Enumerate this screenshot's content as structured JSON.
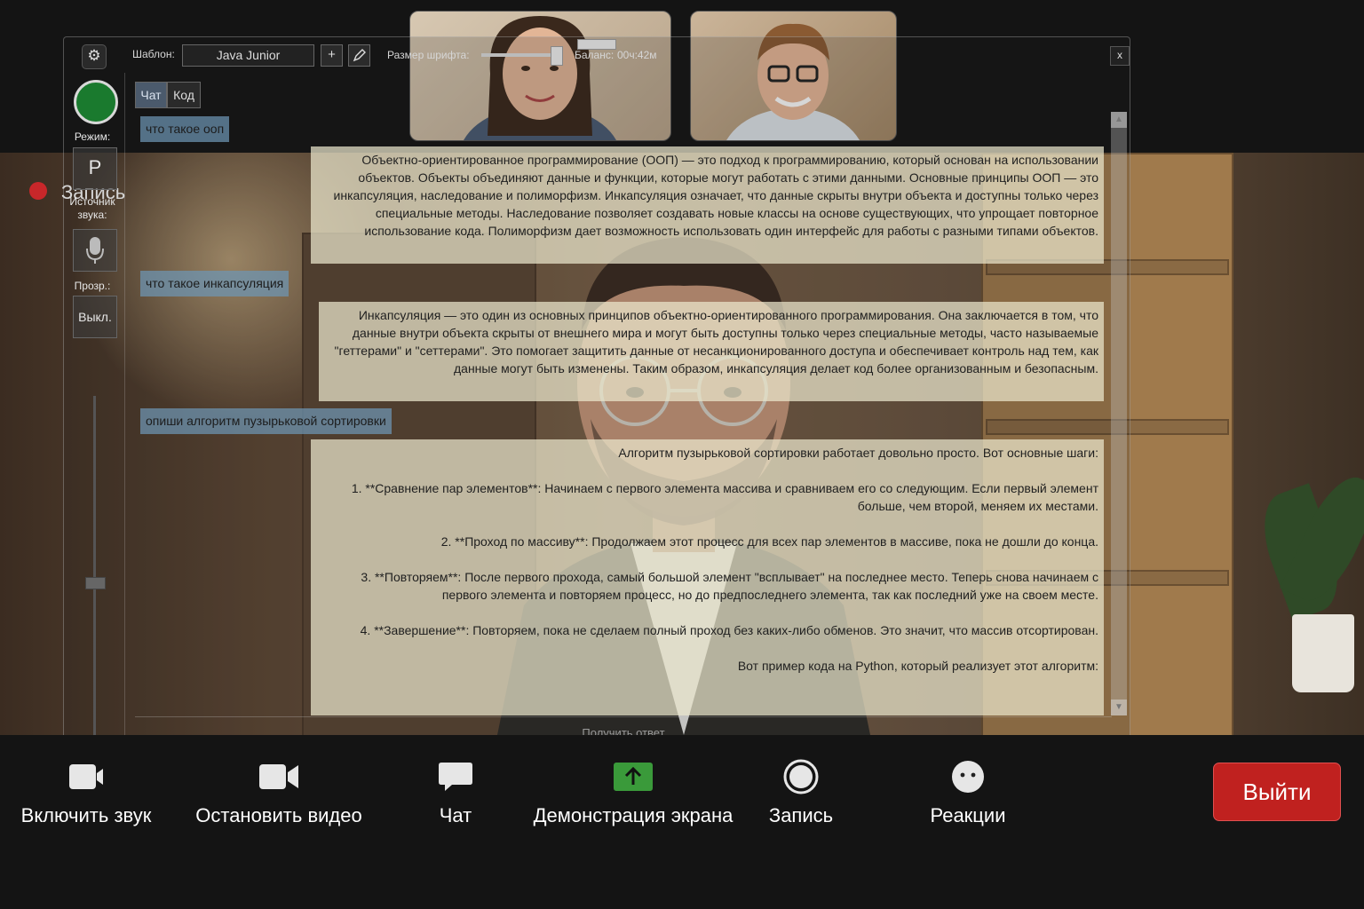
{
  "recording_indicator": {
    "label": "Запись"
  },
  "app": {
    "template_label": "Шаблон:",
    "template_value": "Java Junior",
    "add_label": "+",
    "font_size_label": "Размер шрифта:",
    "balance_label": "Баланс:",
    "balance_value": "00ч:42м",
    "close_label": "x",
    "tabs": [
      {
        "label": "Чат"
      },
      {
        "label": "Код"
      }
    ],
    "sidebar": {
      "mode_label": "Режим:",
      "mode_value": "Р",
      "audio_source_label": "Источник звука:",
      "transparency_label": "Прозр.:",
      "transparency_value": "Выкл."
    },
    "get_answer_label": "Получить ответ"
  },
  "chat": {
    "messages": [
      {
        "role": "user",
        "text": "что такое ооп"
      },
      {
        "role": "assistant",
        "text": "Объектно-ориентированное программирование (ООП) — это подход к программированию, который основан на использовании объектов. Объекты объединяют данные и функции, которые могут работать с этими данными. Основные принципы ООП — это инкапсуляция, наследование и полиморфизм. Инкапсуляция означает, что данные скрыты внутри объекта и доступны только через специальные методы. Наследование позволяет создавать новые классы на основе существующих, что упрощает повторное использование кода. Полиморфизм дает возможность использовать один интерфейс для работы с разными типами объектов."
      },
      {
        "role": "user",
        "text": "что такое инкапсуляция"
      },
      {
        "role": "assistant",
        "text": "Инкапсуляция — это один из основных принципов объектно-ориентированного программирования. Она заключается в том, что данные внутри объекта скрыты от внешнего мира и могут быть доступны только через специальные методы, часто называемые \"геттерами\" и \"сеттерами\". Это помогает защитить данные от несанкционированного доступа и обеспечивает контроль над тем, как данные могут быть изменены. Таким образом, инкапсуляция делает код более организованным и безопасным."
      },
      {
        "role": "user",
        "text": "опиши алгоритм пузырьковой сортировки"
      },
      {
        "role": "assistant",
        "paragraphs": [
          "Алгоритм пузырьковой сортировки работает довольно просто. Вот основные шаги:",
          "1. **Сравнение пар элементов**: Начинаем с первого элемента массива и сравниваем его со следующим. Если первый элемент больше, чем второй, меняем их местами.",
          "2. **Проход по массиву**: Продолжаем этот процесс для всех пар элементов в массиве, пока не дошли до конца.",
          "3. **Повторяем**: После первого прохода, самый большой элемент \"всплывает\" на последнее место. Теперь снова начинаем с первого элемента и повторяем процесс, но до предпоследнего элемента, так как последний уже на своем месте.",
          "4. **Завершение**: Повторяем, пока не сделаем полный проход без каких-либо обменов. Это значит, что массив отсортирован.",
          "Вот пример кода на Python, который реализует этот алгоритм:"
        ]
      }
    ]
  },
  "toolbar": {
    "unmute_label": "Включить звук",
    "stop_video_label": "Остановить видео",
    "chat_label": "Чат",
    "share_label": "Демонстрация экрана",
    "record_label": "Запись",
    "reactions_label": "Реакции",
    "exit_label": "Выйти"
  },
  "colors": {
    "exit": "#c0211f",
    "share": "#3a9a3a",
    "mode_active": "#1a7a2e",
    "rec": "#c8272a"
  }
}
